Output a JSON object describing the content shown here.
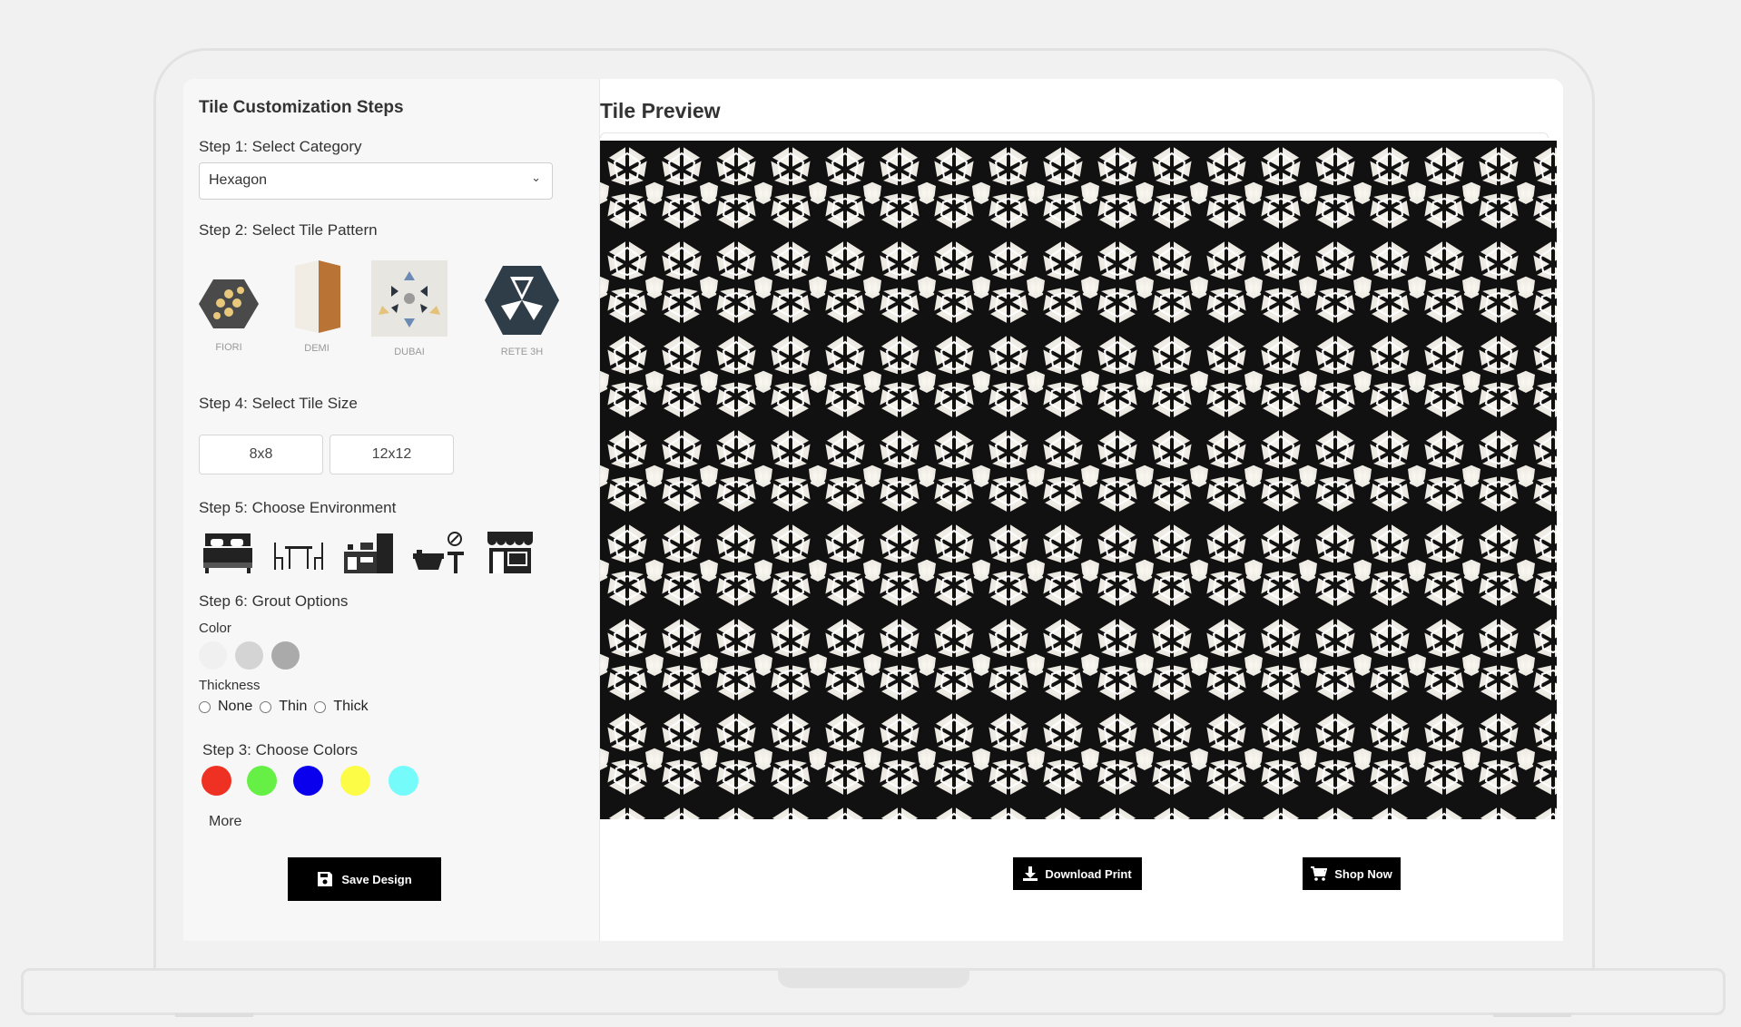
{
  "sidebar": {
    "title": "Tile Customization Steps",
    "step1_label": "Step 1: Select Category",
    "category_value": "Hexagon",
    "step2_label": "Step 2: Select Tile Pattern",
    "patterns": [
      {
        "label": "FIORI",
        "icon": "floral-hexagon-tile-icon"
      },
      {
        "label": "DEMI",
        "icon": "wood-half-tile-icon"
      },
      {
        "label": "DUBAI",
        "icon": "triangle-pattern-tile-icon"
      },
      {
        "label": "RETE 3H",
        "icon": "chevron-hexagon-tile-icon"
      }
    ],
    "step4_label": "Step 4: Select Tile Size",
    "sizes": [
      "8x8",
      "12x12"
    ],
    "step5_label": "Step 5: Choose Environment",
    "environments": [
      "bedroom-icon",
      "dining-room-icon",
      "kitchen-icon",
      "bathroom-icon",
      "storefront-icon"
    ],
    "step6_label": "Step 6: Grout Options",
    "grout_color_label": "Color",
    "grout_colors": [
      "#f0f0f0",
      "#d4d4d4",
      "#aaaaaa"
    ],
    "thickness_label": "Thickness",
    "thickness_options": [
      "None",
      "Thin",
      "Thick"
    ],
    "step3_label": "Step 3: Choose Colors",
    "colors": [
      "#ef3124",
      "#66f046",
      "#0a00ee",
      "#fcfc46",
      "#76fbfb"
    ],
    "more_label": "More",
    "save_label": "Save Design"
  },
  "preview": {
    "title": "Tile Preview",
    "download_label": "Download Print",
    "shop_label": "Shop Now"
  }
}
